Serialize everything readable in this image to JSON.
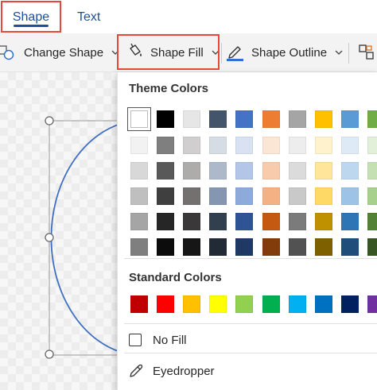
{
  "tabs": {
    "shape": "Shape",
    "text": "Text"
  },
  "toolbar": {
    "change_shape": "Change Shape",
    "shape_fill": "Shape Fill",
    "shape_outline": "Shape Outline"
  },
  "colors": {
    "accent": "#1f4e9e",
    "highlight": "#e8483a"
  },
  "dropdown": {
    "theme_label": "Theme Colors",
    "standard_label": "Standard Colors",
    "no_fill": "No Fill",
    "eyedropper": "Eyedropper",
    "theme_rows": [
      [
        "#ffffff",
        "#000000",
        "#e7e6e6",
        "#44546a",
        "#4472c4",
        "#ed7d31",
        "#a5a5a5",
        "#ffc000",
        "#5b9bd5",
        "#70ad47"
      ],
      [
        "#f2f2f2",
        "#7f7f7f",
        "#d0cece",
        "#d6dce4",
        "#d9e2f3",
        "#fbe5d5",
        "#ededed",
        "#fff2cc",
        "#deebf6",
        "#e2efd9"
      ],
      [
        "#d8d8d8",
        "#595959",
        "#aeabab",
        "#adb9ca",
        "#b4c6e7",
        "#f7cbac",
        "#dbdbdb",
        "#fee599",
        "#bdd7ee",
        "#c5e0b3"
      ],
      [
        "#bfbfbf",
        "#3f3f3f",
        "#757070",
        "#8496b0",
        "#8eaadb",
        "#f4b183",
        "#c9c9c9",
        "#ffd965",
        "#9dc3e6",
        "#a8d08d"
      ],
      [
        "#a5a5a5",
        "#262626",
        "#3a3838",
        "#323f4f",
        "#2f5496",
        "#c45911",
        "#7b7b7b",
        "#bf9000",
        "#2e75b5",
        "#538135"
      ],
      [
        "#7f7f7f",
        "#0c0c0c",
        "#171616",
        "#222a35",
        "#1f3864",
        "#823b0b",
        "#525252",
        "#7f6000",
        "#1e4e79",
        "#375623"
      ]
    ],
    "standard_row": [
      "#c00000",
      "#ff0000",
      "#ffc000",
      "#ffff00",
      "#92d050",
      "#00b050",
      "#00b0f0",
      "#0070c0",
      "#002060",
      "#7030a0"
    ]
  }
}
